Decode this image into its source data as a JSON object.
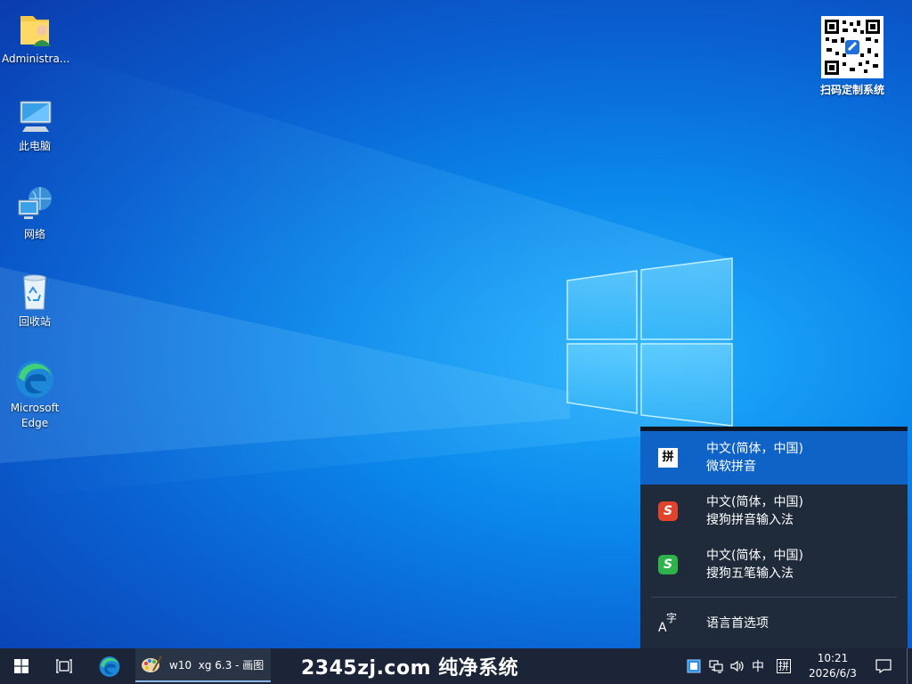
{
  "desktop": {
    "icons": [
      {
        "label": "Administra...",
        "icon": "user-folder-icon"
      },
      {
        "label": "此电脑",
        "icon": "this-pc-icon"
      },
      {
        "label": "网络",
        "icon": "network-icon"
      },
      {
        "label": "回收站",
        "icon": "recycle-bin-icon"
      },
      {
        "label": "Microsoft\nEdge",
        "icon": "edge-icon"
      }
    ],
    "qr_caption": "扫码定制系统"
  },
  "ime_menu": {
    "items": [
      {
        "line1": "中文(简体，中国)",
        "line2": "微软拼音",
        "badge": "拼",
        "active": true
      },
      {
        "line1": "中文(简体，中国)",
        "line2": "搜狗拼音输入法",
        "badge": "S",
        "badge_color": "#e0442c"
      },
      {
        "line1": "中文(简体，中国)",
        "line2": "搜狗五笔输入法",
        "badge": "S",
        "badge_color": "#2db34a"
      }
    ],
    "language_prefs": "语言首选项"
  },
  "taskbar": {
    "paint_window_title": "w10  xg 6.3 - 画图",
    "watermark": "2345zj.com  纯净系统",
    "tray": {
      "ime_mode": "中",
      "ime_badge": "拼"
    },
    "clock": {
      "time": "10:21",
      "date": "2026/6/3"
    }
  },
  "colors": {
    "accent": "#0f62c6",
    "taskbar": "#1b2537",
    "flyout": "#1f2a3b"
  }
}
